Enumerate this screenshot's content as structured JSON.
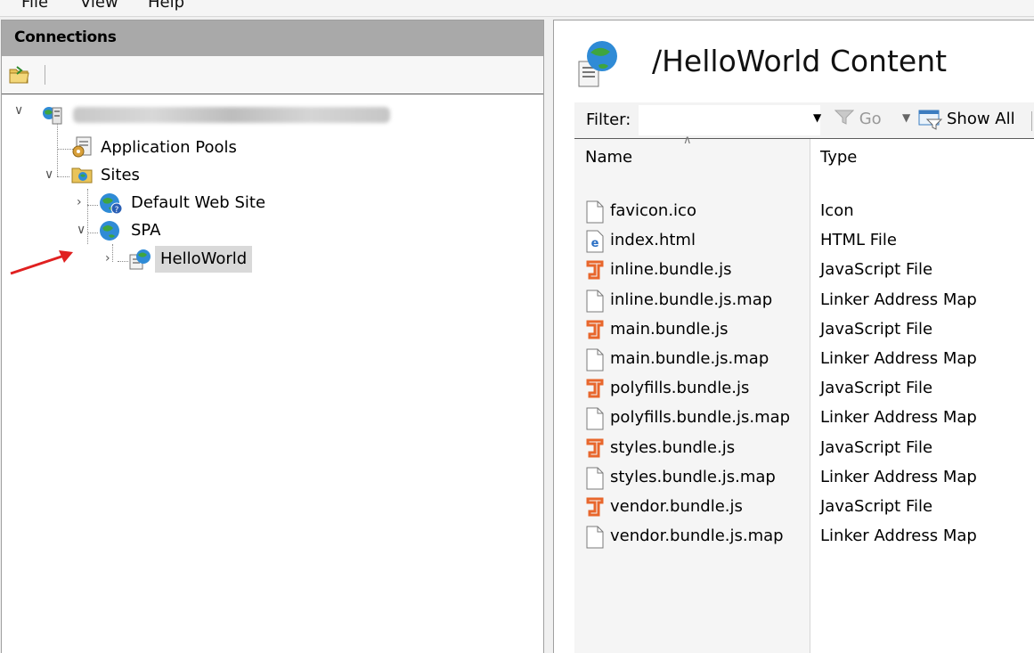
{
  "menu": {
    "file": "File",
    "view": "View",
    "help": "Help"
  },
  "connections": {
    "title": "Connections",
    "tree": {
      "app_pools": "Application Pools",
      "sites": "Sites",
      "default_site": "Default Web Site",
      "spa": "SPA",
      "helloworld": "HelloWorld"
    }
  },
  "content": {
    "title": "/HelloWorld Content",
    "filter_label": "Filter:",
    "go_label": "Go",
    "show_all_label": "Show All",
    "columns": {
      "name": "Name",
      "type": "Type"
    },
    "files": [
      {
        "name": "favicon.ico",
        "type": "Icon",
        "icon": "file-icon"
      },
      {
        "name": "index.html",
        "type": "HTML File",
        "icon": "html-file-icon"
      },
      {
        "name": "inline.bundle.js",
        "type": "JavaScript File",
        "icon": "js-file-icon"
      },
      {
        "name": "inline.bundle.js.map",
        "type": "Linker Address Map",
        "icon": "file-icon"
      },
      {
        "name": "main.bundle.js",
        "type": "JavaScript File",
        "icon": "js-file-icon"
      },
      {
        "name": "main.bundle.js.map",
        "type": "Linker Address Map",
        "icon": "file-icon"
      },
      {
        "name": "polyfills.bundle.js",
        "type": "JavaScript File",
        "icon": "js-file-icon"
      },
      {
        "name": "polyfills.bundle.js.map",
        "type": "Linker Address Map",
        "icon": "file-icon"
      },
      {
        "name": "styles.bundle.js",
        "type": "JavaScript File",
        "icon": "js-file-icon"
      },
      {
        "name": "styles.bundle.js.map",
        "type": "Linker Address Map",
        "icon": "file-icon"
      },
      {
        "name": "vendor.bundle.js",
        "type": "JavaScript File",
        "icon": "js-file-icon"
      },
      {
        "name": "vendor.bundle.js.map",
        "type": "Linker Address Map",
        "icon": "file-icon"
      }
    ]
  },
  "colors": {
    "js_icon": "#e8662c",
    "html_icon": "#2a6fc4",
    "annotation_arrow": "#e02020",
    "header_bg": "#a9a9a9"
  }
}
